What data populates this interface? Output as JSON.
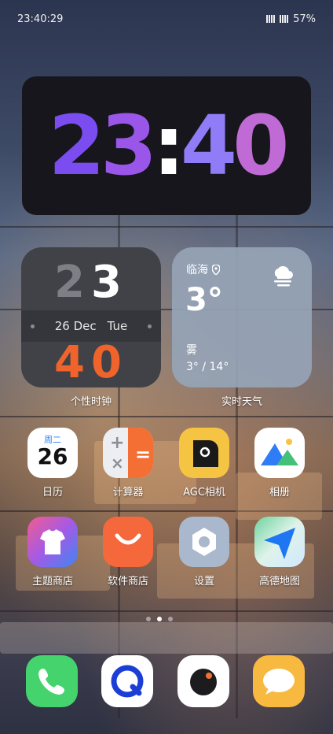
{
  "status_bar": {
    "time": "23:40:29",
    "battery": "57%"
  },
  "big_clock": {
    "h1": "2",
    "h2": "3",
    "colon": ":",
    "m1": "4",
    "m2": "0"
  },
  "clock_widget": {
    "hour_tens": "2",
    "hour_ones": "3",
    "date": "26 Dec",
    "weekday": "Tue",
    "minutes": "40",
    "label": "个性时钟"
  },
  "weather_widget": {
    "city": "临海",
    "temp": "3°",
    "condition": "雾",
    "range": "3° / 14°",
    "label": "实时天气"
  },
  "apps": [
    {
      "label": "日历",
      "icon": "calendar-icon",
      "weekday": "周二",
      "day": "26"
    },
    {
      "label": "计算器",
      "icon": "calculator-icon"
    },
    {
      "label": "AGC相机",
      "icon": "camera-app-icon"
    },
    {
      "label": "相册",
      "icon": "gallery-icon"
    },
    {
      "label": "主题商店",
      "icon": "theme-store-icon"
    },
    {
      "label": "软件商店",
      "icon": "app-store-icon"
    },
    {
      "label": "设置",
      "icon": "settings-icon"
    },
    {
      "label": "高德地图",
      "icon": "map-icon"
    }
  ],
  "dock": [
    {
      "icon": "phone-icon"
    },
    {
      "icon": "browser-icon"
    },
    {
      "icon": "camera-icon"
    },
    {
      "icon": "messages-icon"
    }
  ],
  "page_indicator": {
    "pages": 3,
    "current": 2
  },
  "colors": {
    "clock_accent": "#f0642c",
    "purple": "#7b4df0",
    "weather_bg": "#96a4b6"
  }
}
